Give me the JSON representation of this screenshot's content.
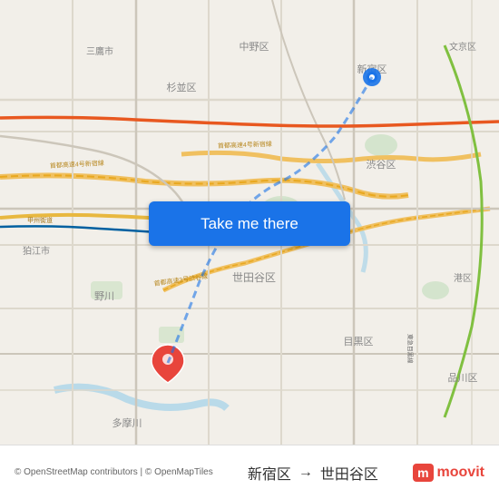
{
  "map": {
    "background_color": "#e8e0d8",
    "origin_district": "新宿区",
    "destination_district": "世田谷区"
  },
  "button": {
    "label": "Take me there",
    "background_color": "#1a73e8",
    "text_color": "#ffffff"
  },
  "footer": {
    "attribution": "© OpenStreetMap contributors | © OpenMapTiles",
    "origin_label": "新宿区",
    "arrow": "→",
    "destination_label": "世田谷区",
    "brand": "moovit"
  },
  "markers": {
    "origin_color": "#1a73e8",
    "destination_color": "#e8453c"
  }
}
